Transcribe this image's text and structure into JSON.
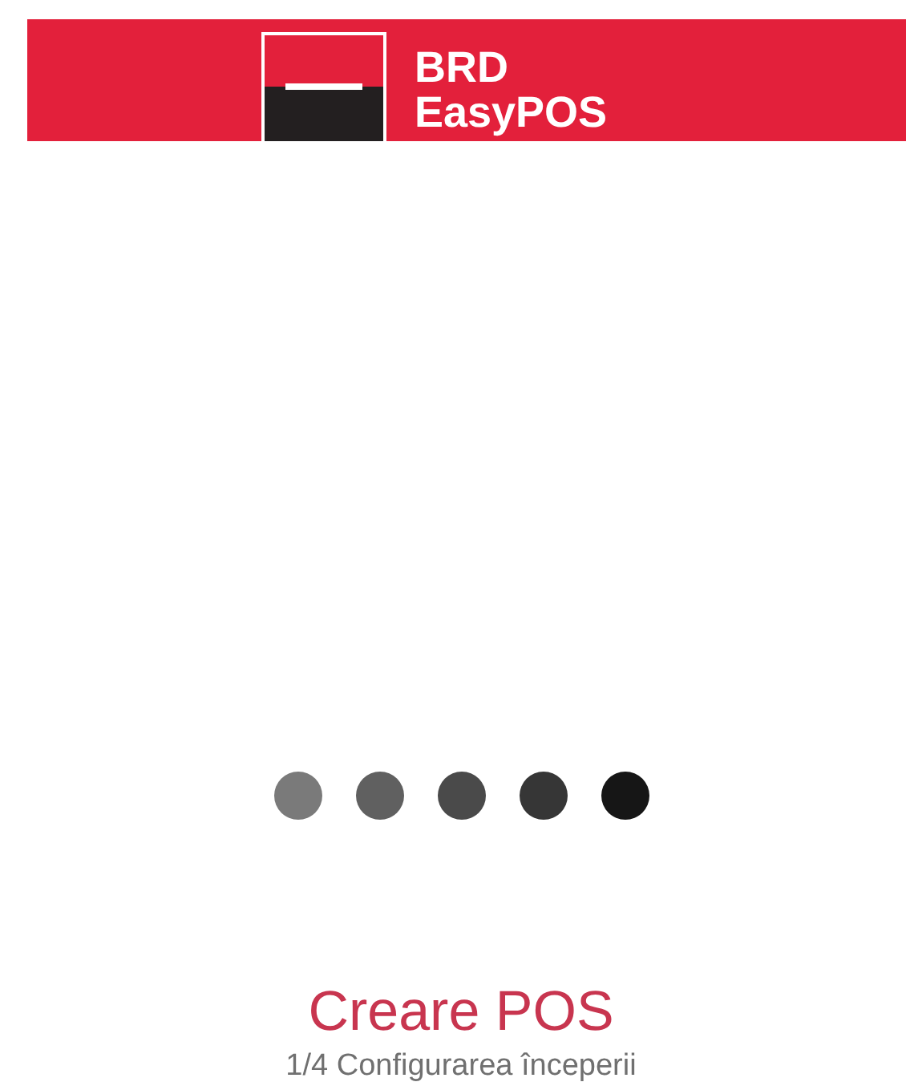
{
  "header": {
    "brand_line_1": "BRD",
    "brand_line_2": "EasyPOS"
  },
  "loader": {
    "dots": [
      {
        "color": "#7a7a7a"
      },
      {
        "color": "#606060"
      },
      {
        "color": "#4a4a4a"
      },
      {
        "color": "#363636"
      },
      {
        "color": "#161616"
      }
    ]
  },
  "title": "Creare POS",
  "step": "1/4 Configurarea începerii"
}
